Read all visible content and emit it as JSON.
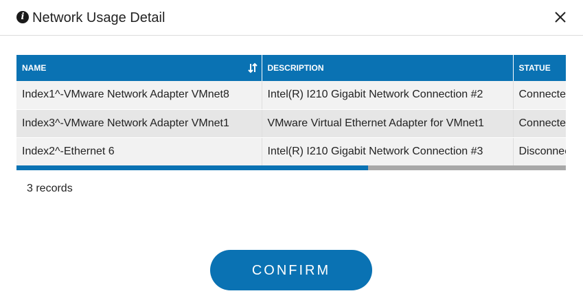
{
  "dialog": {
    "title": "Network Usage Detail",
    "icons": {
      "title": "info-icon",
      "close": "close-icon",
      "sort": "sort-icon"
    }
  },
  "table": {
    "columns": [
      "NAME",
      "DESCRIPTION",
      "STATUE"
    ],
    "rows": [
      {
        "name": "Index1^-VMware Network Adapter VMnet8",
        "description": "Intel(R) I210 Gigabit Network Connection #2",
        "status": "Connected"
      },
      {
        "name": "Index3^-VMware Network Adapter VMnet1",
        "description": "VMware Virtual Ethernet Adapter for VMnet1",
        "status": "Connected"
      },
      {
        "name": "Index2^-Ethernet 6",
        "description": "Intel(R) I210 Gigabit Network Connection #3",
        "status": "Disconnected"
      }
    ]
  },
  "footer": {
    "records": "3 records",
    "confirm_label": "CONFIRM"
  },
  "colors": {
    "accent": "#0a72b3",
    "header_text": "#ffffff",
    "scroll_track": "#a8a8a8"
  }
}
